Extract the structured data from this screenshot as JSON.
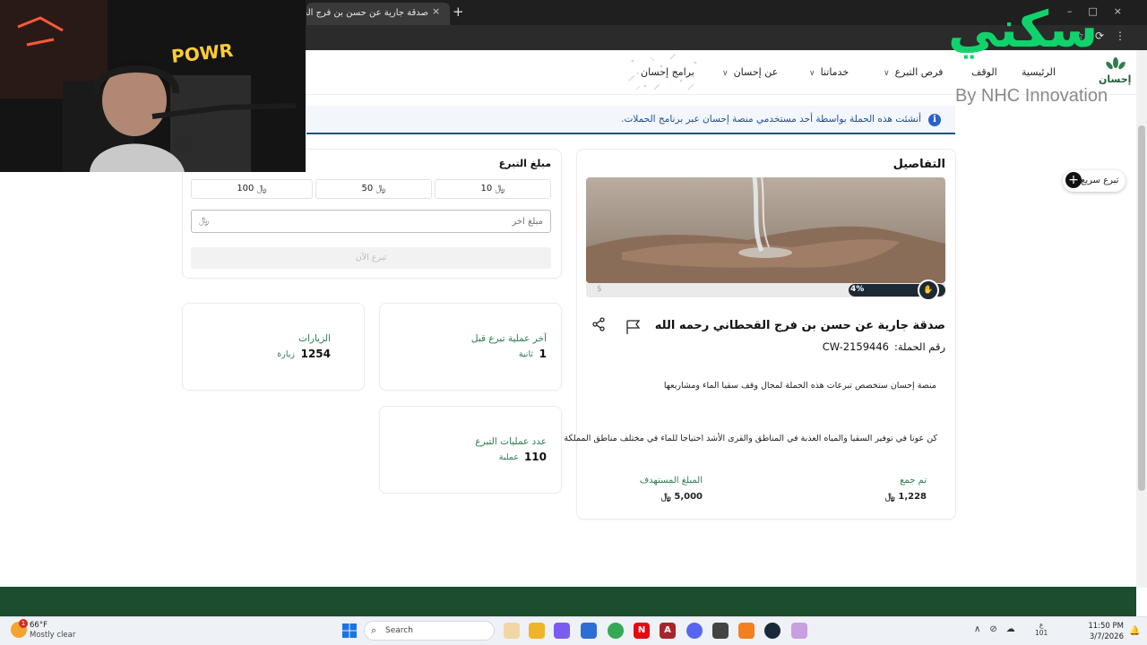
{
  "browser": {
    "tab_title": "صدقة جارية عن حسن بن فرج القح",
    "tab_close": "×",
    "new_tab": "+"
  },
  "watermark": {
    "arabic": "سكني",
    "sub": "By NHC Innovation"
  },
  "logo": {
    "text": "إحسان",
    "color": "#1f5c3a"
  },
  "nav": {
    "items": [
      {
        "label": "الرئيسية",
        "has_chevron": false
      },
      {
        "label": "الوقف",
        "has_chevron": false
      },
      {
        "label": "فرص التبرع",
        "has_chevron": true
      },
      {
        "label": "خدماتنا",
        "has_chevron": true
      },
      {
        "label": "عن إحسان",
        "has_chevron": true
      },
      {
        "label": "برامج إحسان",
        "has_chevron": false
      }
    ],
    "chevron_glyph": "∨"
  },
  "info_banner": {
    "text": "أنشئت هذه الحملة بواسطة أحد مستخدمي منصة إحسان عبر برنامج الحملات.",
    "icon": "i"
  },
  "quick_donate": {
    "label": "تبرع سريع",
    "icon": "+"
  },
  "details": {
    "title": "التفاصيل",
    "progress_percent_label": "4%",
    "progress_fraction": 0.04,
    "campaign_title": "صدقة جارية عن حسن بن فرج القحطاني رحمه الله",
    "campaign_number_label": "رقم الحملة:",
    "campaign_number": "CW-2159446",
    "description_1": "منصة إحسان ستخصص تبرعات هذه الحملة لمجال وقف سقيا الماء ومشاريعها",
    "description_2": "كن عونا في توفير السقيا والمياه العذبة في المناطق والقرى الأشد احتياجا للماء في مختلف مناطق المملكة",
    "raised_label": "تم جمع",
    "raised_value": "1,228",
    "target_label": "المبلغ المستهدف",
    "target_value": "5,000",
    "currency": "﷼"
  },
  "donation": {
    "title": "مبلغ التبرع",
    "amounts": [
      "10",
      "50",
      "100"
    ],
    "other_placeholder": "مبلغ آخر",
    "donate_now": "تبرع الآن",
    "currency": "﷼"
  },
  "stats": {
    "last": {
      "label": "آخر عملية تبرع قبل",
      "value": "1",
      "unit": "ثانية"
    },
    "visits": {
      "label": "الزيارات",
      "value": "1254",
      "unit": "زيارة"
    },
    "count": {
      "label": "عدد عمليات التبرع",
      "value": "110",
      "unit": "عملية"
    }
  },
  "taskbar": {
    "weather_temp": "66°F",
    "weather_desc": "Mostly clear",
    "weather_badge": "1",
    "search": "Search",
    "lang_top": "ع",
    "lang_bottom": "101",
    "time": "11:50 PM",
    "date": "3/7/2026"
  },
  "webcam_sign": "POWR"
}
